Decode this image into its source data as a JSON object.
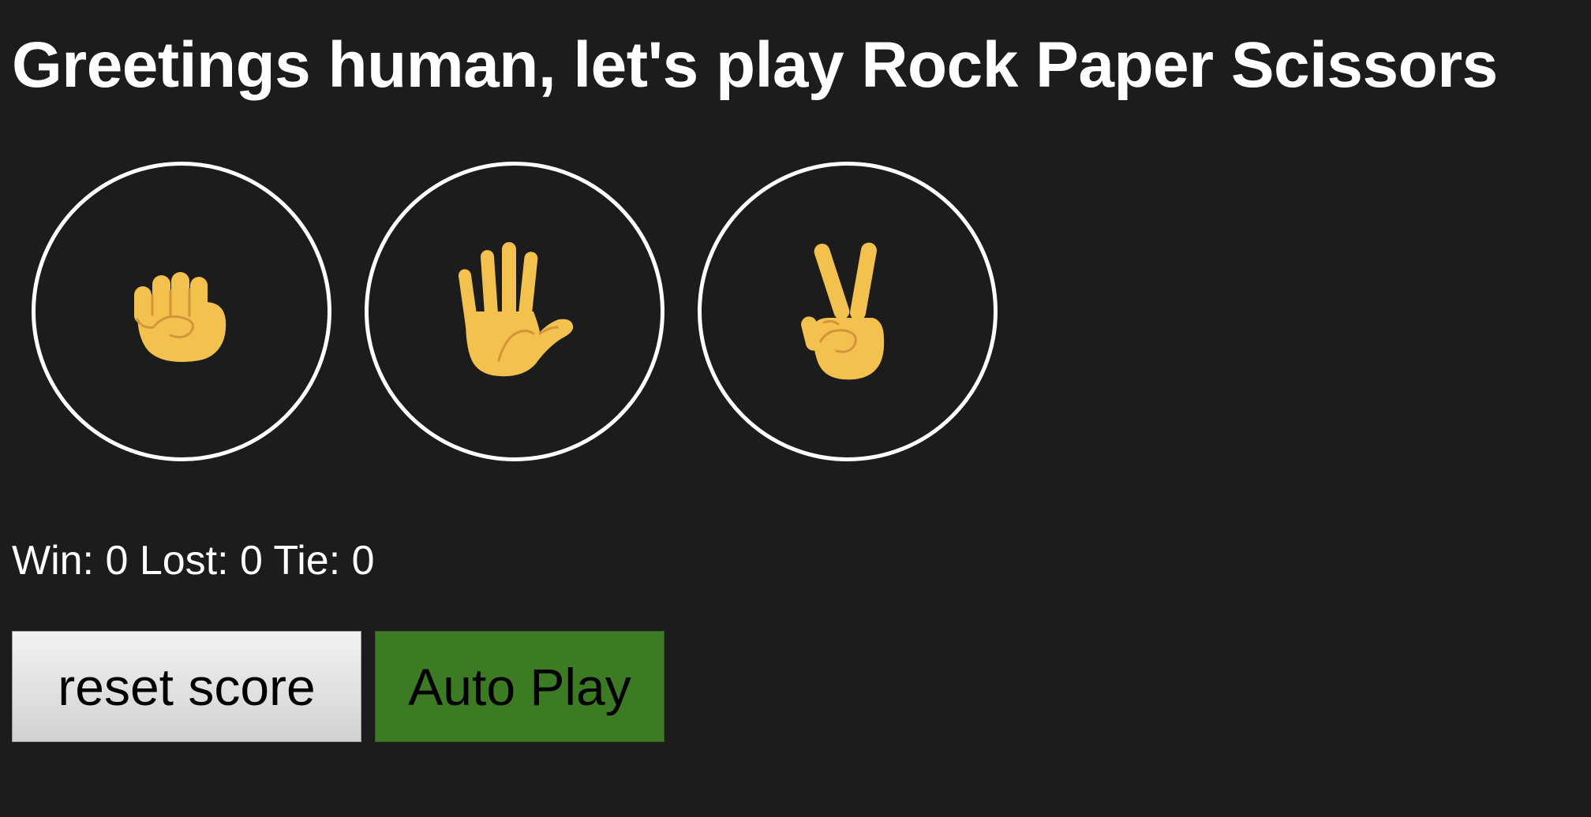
{
  "header": {
    "title": "Greetings human, let's play Rock Paper Scissors"
  },
  "moves": [
    {
      "name": "rock",
      "icon": "raised-fist-icon"
    },
    {
      "name": "paper",
      "icon": "raised-hand-icon"
    },
    {
      "name": "scissors",
      "icon": "victory-hand-icon"
    }
  ],
  "score": {
    "text": "Win: 0 Lost: 0 Tie: 0",
    "win": 0,
    "lost": 0,
    "tie": 0
  },
  "controls": {
    "reset_label": "reset score",
    "auto_play_label": "Auto Play"
  },
  "colors": {
    "background": "#1c1c1c",
    "text": "#ffffff",
    "skin": "#f2c14e",
    "skin_line": "#d4953a",
    "auto_play_bg": "#3c7a23"
  }
}
